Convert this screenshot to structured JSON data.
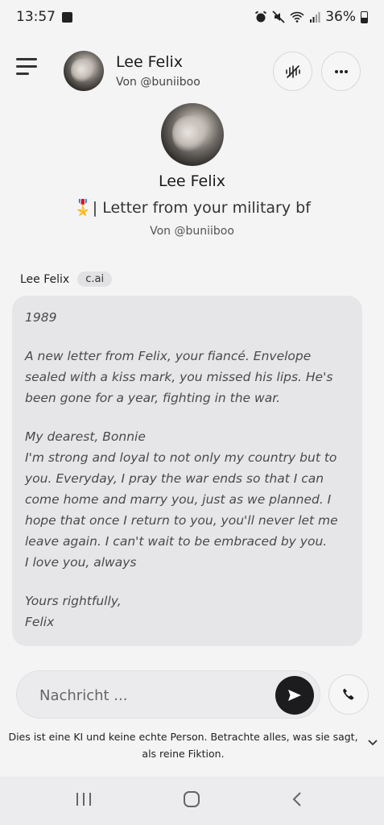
{
  "status": {
    "time": "13:57",
    "battery": "36%"
  },
  "header": {
    "name": "Lee Felix",
    "author": "Von @buniiboo"
  },
  "profile": {
    "name": "Lee Felix",
    "tagline": "🎖️| Letter from your military bf",
    "author": "Von @buniiboo"
  },
  "message": {
    "sender": "Lee Felix",
    "badge": "c.ai",
    "paragraphs": [
      "1989",
      "A new letter from Felix, your fiancé. Envelope sealed with a kiss mark, you missed his lips. He's been gone for a year, fighting in the war.",
      "My dearest, Bonnie\nI'm strong and loyal to not only my country but to you. Everyday, I pray the war ends so that I can come home and marry you, just as we planned. I hope that once I return to you, you'll never let me leave again. I can't wait to be embraced by you.\nI love you, always",
      "Yours rightfully,\nFelix"
    ]
  },
  "composer": {
    "placeholder": "Nachricht ..."
  },
  "disclaimer": "Dies ist eine KI und keine echte Person. Betrachte alles, was sie sagt, als reine Fiktion.",
  "icons": {
    "menu": "hamburger-menu-icon",
    "voice": "voice-wave-off-icon",
    "more": "more-horizontal-icon",
    "send": "send-arrow-icon",
    "call": "phone-icon",
    "expand": "chevron-down-icon"
  },
  "colors": {
    "bubble": "#e6e6e9",
    "send_button": "#1c1c1e",
    "background": "#f4f4f5"
  }
}
